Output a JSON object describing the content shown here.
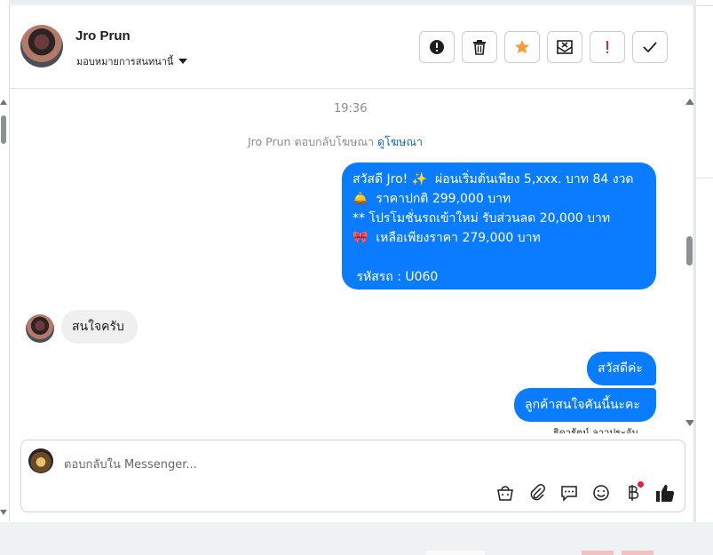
{
  "header": {
    "contact_name": "Jro Prun",
    "assign_label": "มอบหมายการสนทนานี้",
    "toolbar": [
      {
        "icon": "info-circle-icon"
      },
      {
        "icon": "trash-icon"
      },
      {
        "icon": "star-icon",
        "color": "#f29d38"
      },
      {
        "icon": "envelope-x-icon"
      },
      {
        "icon": "exclamation-icon",
        "color": "#e41e3f"
      },
      {
        "icon": "check-icon"
      }
    ]
  },
  "chat": {
    "timestamp": "19:36",
    "reply_note": "Jro Prun ตอบกลับโฆษณา",
    "reply_link": "ดูโฆษณา",
    "outgoing_1_lines": [
      "สวัสดี Jro! ✨  ผ่อนเริ่มต้นเพียง 5,xxx. บาท 84 งวด",
      "🛎️  ราคาปกติ 299,000 บาท",
      "** โปรโมชั่นรถเข้าใหม่ รับส่วนลด 20,000 บาท",
      "🎀  เหลือเพียงราคา 279,000 บาท",
      "",
      " รหัสรถ : U060"
    ],
    "incoming_1": "สนใจครับ",
    "outgoing_2": "สวัสดีค่ะ",
    "outgoing_3": "ลูกค้าสนใจคันนี้นะคะ",
    "sender_name": "ธิดารัตน์ ลาวประจัน"
  },
  "composer": {
    "placeholder": "ตอบกลับใน Messenger...",
    "tools": [
      "shopping-bag-icon",
      "paperclip-icon",
      "chat-bubble-icon",
      "smiley-icon",
      "baht-icon",
      "thumbs-up-icon"
    ]
  },
  "colors": {
    "accent": "#0a7cff",
    "star": "#f29d38",
    "alert": "#e41e3f"
  }
}
